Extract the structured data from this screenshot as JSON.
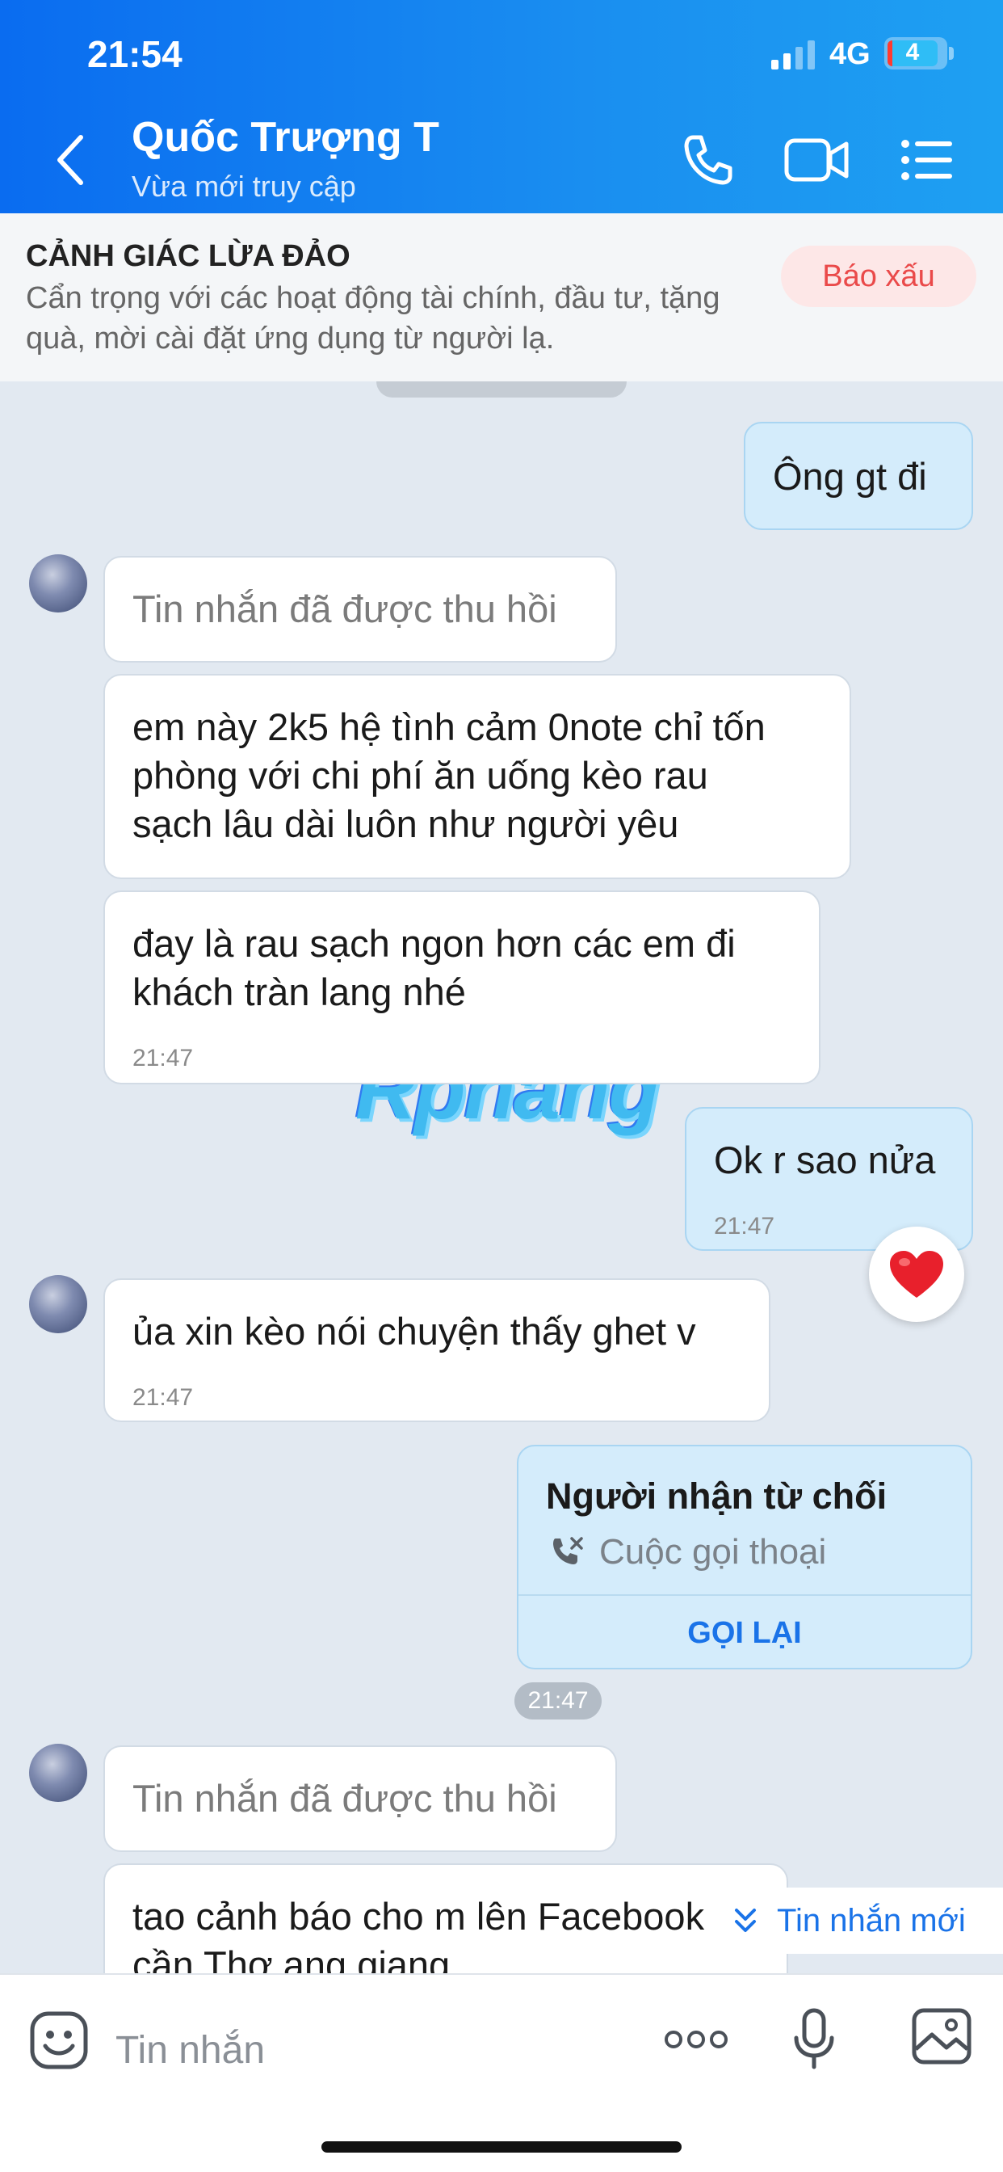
{
  "status_bar": {
    "time": "21:54",
    "network": "4G",
    "battery": "4"
  },
  "header": {
    "name": "Quốc Trượng T",
    "status": "Vừa mới truy cập",
    "icons": [
      "back-icon",
      "phone-icon",
      "video-icon",
      "menu-icon"
    ]
  },
  "warning": {
    "title": "CẢNH GIÁC LỪA ĐẢO",
    "text": "Cẩn trọng với các hoạt động tài chính, đầu tư, tặng quà, mời cài đặt ứng dụng từ người lạ.",
    "report_label": "Báo xấu"
  },
  "messages": {
    "m1": {
      "text": "Ông gt đi"
    },
    "m2": {
      "text": "Tin nhắn đã được thu hồi"
    },
    "m3": {
      "line1": "em này 2k5 hệ tình cảm 0note chỉ tốn",
      "line2": "phòng với chi phí ăn uống kèo rau",
      "line3": "sạch lâu dài luôn như người yêu"
    },
    "m4": {
      "line1": "đay là rau sạch ngon hơn các em đi",
      "line2": "khách tràn lang nhé",
      "time": "21:47"
    },
    "m5": {
      "text": "Ok r sao nửa",
      "time": "21:47",
      "reaction": "heart-icon"
    },
    "m6": {
      "text": "ủa xin kèo nói chuyện thấy ghet v",
      "time": "21:47"
    },
    "call": {
      "title": "Người nhận từ chối",
      "subtitle": "Cuộc gọi thoại",
      "action": "GỌI LẠI"
    },
    "time_divider": "21:47",
    "m7": {
      "text": "Tin nhắn đã được thu hồi"
    },
    "m8": {
      "line1": "tao cảnh báo cho m lên Facebook",
      "line2": "cần Thơ ang giang"
    }
  },
  "new_messages_label": "Tin nhắn mới",
  "watermark": "Rphang",
  "input_bar": {
    "placeholder": "Tin nhắn",
    "icons": [
      "emoji-icon",
      "more-icon",
      "microphone-icon",
      "image-icon"
    ]
  },
  "colors": {
    "header": "#0a6cf0",
    "outgoing_bubble": "#d4ecfb",
    "incoming_bubble": "#ffffff",
    "background": "#e2e9f1",
    "report": "#ea4a4a",
    "link": "#1a73e8"
  }
}
